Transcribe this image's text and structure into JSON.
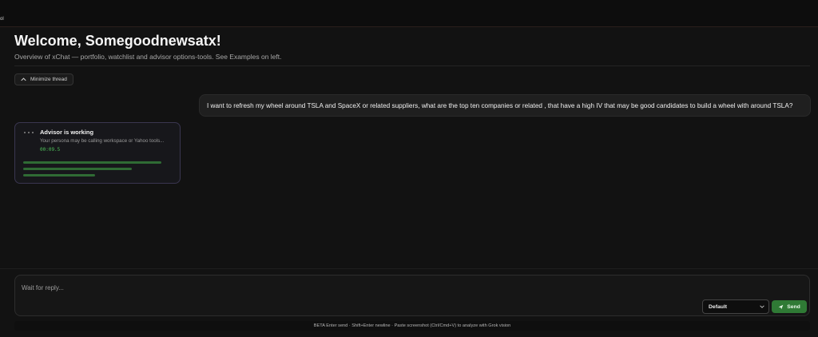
{
  "topbar": {
    "mark": "ol"
  },
  "header": {
    "title": "Welcome, Somegoodnewsatx!",
    "subtitle": "Overview of xChat — portfolio, watchlist and advisor options-tools. See Examples on left."
  },
  "thread": {
    "minimize_label": "Minimize thread",
    "user_message": "I want to refresh my wheel around TSLA and SpaceX or related suppliers, what are the top ten companies or related , that have a high IV that may be good candidates to build a wheel with around TSLA?"
  },
  "advisor": {
    "title": "Advisor is working",
    "subtitle": "Your persona may be calling workspace or Yahoo tools...",
    "timer": "00:09.5",
    "progress": [
      {
        "fraction": 1.0
      },
      {
        "fraction": 1.0
      },
      {
        "fraction": 1.0
      }
    ]
  },
  "composer": {
    "placeholder": "Wait for reply...",
    "model_selected": "Default",
    "send_label": "Send"
  },
  "hint": "BETA  Enter send · Shift+Enter newline · Paste screenshot (Ctrl/Cmd+V) to analyze with Grok vision",
  "colors": {
    "accent": "#2f7a35",
    "timer": "#4fc25a",
    "card_border": "#3a3650",
    "background": "#121212"
  }
}
